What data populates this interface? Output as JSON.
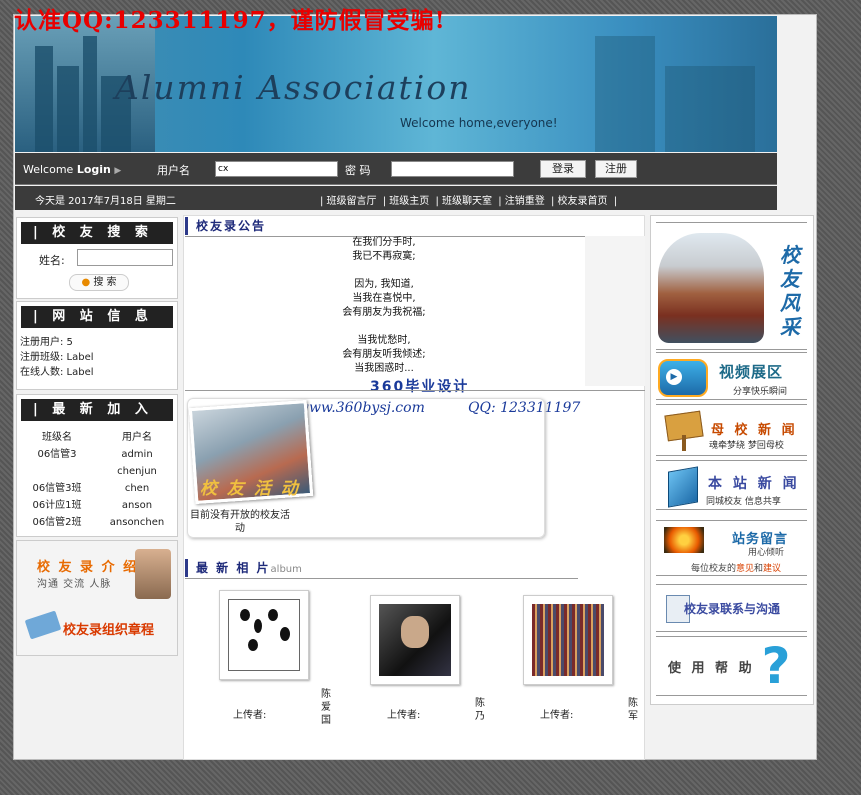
{
  "warning": "认准QQ:123311197，谨防假冒受骗!",
  "banner": {
    "title": "Alumni Association",
    "welcome": "Welcome home,everyone!"
  },
  "login": {
    "welcome_label": "Welcome",
    "login_label": "Login",
    "arrow": "▶",
    "username_label": "用户名",
    "username_value": "cx",
    "password_label": "密 码",
    "login_button": "登录",
    "register_button": "注册"
  },
  "nav": {
    "date": "今天是 2017年7月18日 星期二",
    "links": [
      "| 班级留言厅",
      "| 班级主页",
      "| 班级聊天室",
      "| 注销重登",
      "| 校友录首页",
      "|"
    ]
  },
  "search": {
    "header": "| 校 友 搜 索",
    "name_label": "姓名:",
    "button": "搜 索"
  },
  "site_info": {
    "header": "| 网 站 信 息",
    "rows": [
      "注册用户: 5",
      "注册班级: Label",
      "在线人数: Label"
    ]
  },
  "latest": {
    "header": "| 最 新 加 入",
    "col1": "班级名",
    "col2": "用户名",
    "rows": [
      [
        "06信管3",
        "admin"
      ],
      [
        "",
        "chenjun"
      ],
      [
        "06信管3班",
        "chen"
      ],
      [
        "06计应1班",
        "anson"
      ],
      [
        "06信管2班",
        "ansonchen"
      ]
    ]
  },
  "intro": {
    "title": "校 友 录 介 绍",
    "sub": "沟通 交流 人脉",
    "charter": "校友录组织章程"
  },
  "notice": {
    "header": "校友录公告",
    "poem": [
      "在我们分手时,",
      "我已不再寂寞;",
      "",
      "因为, 我知道,",
      "当我在喜悦中,",
      "会有朋友为我祝福;",
      "",
      "当我忧愁时,",
      "会有朋友听我倾述;",
      "当我困惑时..."
    ]
  },
  "watermark": {
    "line1": "360毕业设计",
    "url": "www.360bysj.com",
    "qq": "QQ: 123311197"
  },
  "activity": {
    "label": "校 友 活 动",
    "empty_text": "目前没有开放的校友活动"
  },
  "album": {
    "header": "最 新 相 片",
    "header_en": "album",
    "uploader_label": "上传者:",
    "names": [
      "陈爱国",
      "陈乃",
      "陈军"
    ]
  },
  "right": {
    "style_chars": [
      "校",
      "友",
      "风",
      "采"
    ],
    "video_title": "视频展区",
    "video_sub": "分享快乐瞬间",
    "school_news": "母 校 新 闻",
    "school_news_sub": "魂牵梦绕 梦回母校",
    "site_news": "本 站 新 闻",
    "site_news_sub": "同城校友 信息共享",
    "guestbook": "站务留言",
    "guestbook_sub1": "用心倾听",
    "guestbook_sub2_a": "每位校友的",
    "guestbook_sub2_b": "意见",
    "guestbook_sub2_c": "和",
    "guestbook_sub2_d": "建议",
    "contact": "校友录联系与沟通",
    "help": "使 用 帮 助"
  },
  "colors": {
    "warning": "#e80000",
    "dark_bar": "#3c3c3c",
    "accent_blue": "#1e2a7a",
    "orange": "#e86a00"
  }
}
